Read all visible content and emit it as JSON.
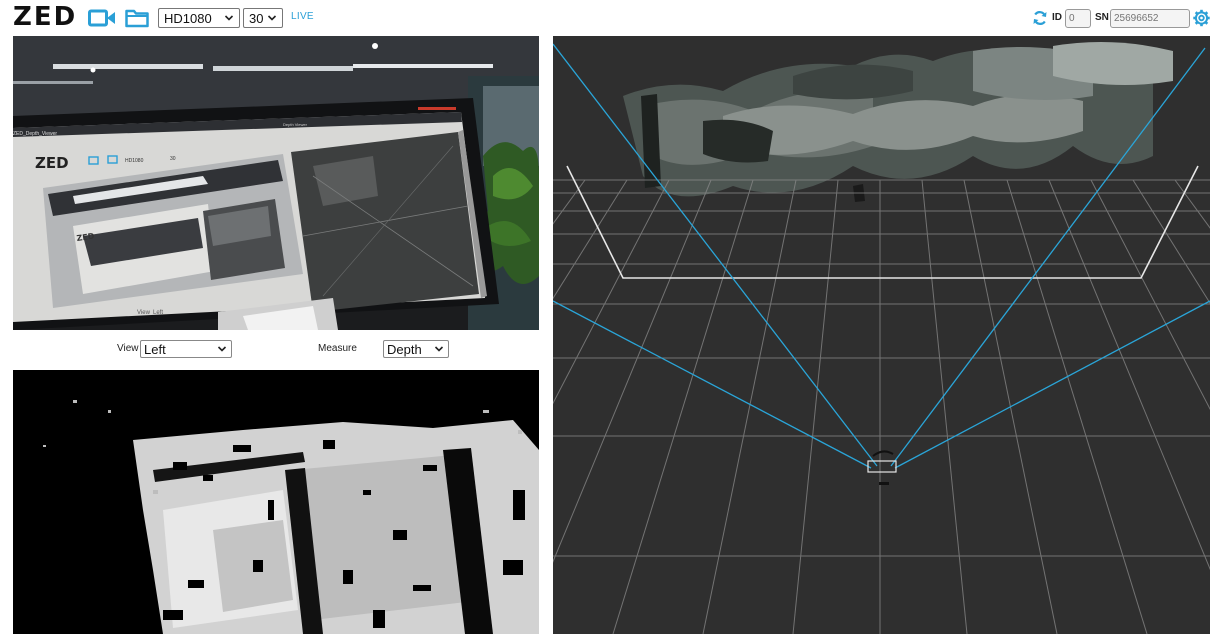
{
  "toolbar": {
    "logo": "ZED",
    "camera_icon": "video-camera-icon",
    "folder_icon": "folder-icon",
    "resolution": "HD1080",
    "fps": "30",
    "live": "LIVE",
    "sync_icon": "sync-icon",
    "id_label": "ID",
    "id_placeholder": "0",
    "sn_label": "SN",
    "sn_placeholder": "25696652",
    "settings_icon": "gear-icon",
    "accent_color": "#2a9fd6"
  },
  "view_controls": {
    "view_label": "View",
    "view_value": "Left",
    "measure_label": "Measure",
    "measure_value": "Depth"
  },
  "inner_screen": {
    "logo": "ZED",
    "resolution": "HD1080",
    "fps": "30",
    "tab_title": "ZED_Depth_Viewer",
    "window_title": "Depth Viewer",
    "view_label": "View",
    "view_value": "Left"
  },
  "colors": {
    "background": "#ffffff",
    "point_cloud_bg": "#2f2f2f",
    "frustum_lines": "#2aa5d8",
    "grid_lines": "#8a8a8a"
  }
}
